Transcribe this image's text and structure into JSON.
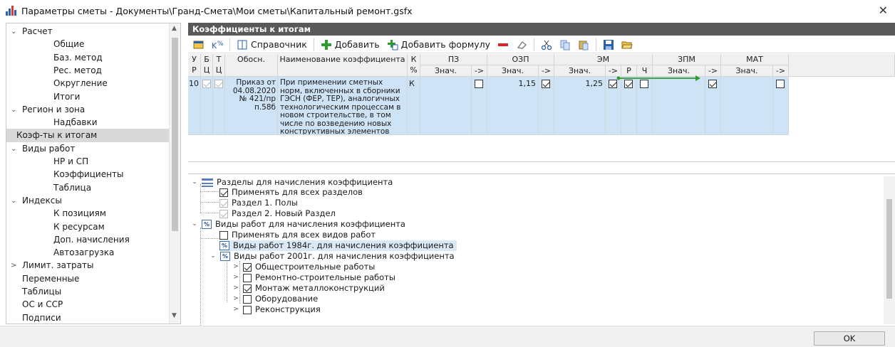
{
  "window": {
    "title": "Параметры сметы - Документы\\Гранд-Смета\\Мои сметы\\Капитальный ремонт.gsfx"
  },
  "sidebar": {
    "items": [
      {
        "label": "Расчет",
        "level": 0,
        "arrow": "⌄"
      },
      {
        "label": "Общие",
        "level": 1
      },
      {
        "label": "Баз. метод",
        "level": 1
      },
      {
        "label": "Рес. метод",
        "level": 1
      },
      {
        "label": "Округление",
        "level": 1
      },
      {
        "label": "Итоги",
        "level": 1
      },
      {
        "label": "Регион и зона",
        "level": 0,
        "arrow": "⌄"
      },
      {
        "label": "Надбавки",
        "level": 1
      },
      {
        "label": "Коэф-ты к итогам",
        "level": 0,
        "selected": true
      },
      {
        "label": "Виды работ",
        "level": 0,
        "arrow": "⌄"
      },
      {
        "label": "НР и СП",
        "level": 1
      },
      {
        "label": "Коэффициенты",
        "level": 1
      },
      {
        "label": "Таблица",
        "level": 1
      },
      {
        "label": "Индексы",
        "level": 0,
        "arrow": "⌄"
      },
      {
        "label": "К позициям",
        "level": 1
      },
      {
        "label": "К ресурсам",
        "level": 1
      },
      {
        "label": "Доп. начисления",
        "level": 1
      },
      {
        "label": "Автозагрузка",
        "level": 1
      },
      {
        "label": "Лимит. затраты",
        "level": 0,
        "arrow": ">"
      },
      {
        "label": "Переменные",
        "level": 0
      },
      {
        "label": "Таблицы",
        "level": 0
      },
      {
        "label": "ОС и ССР",
        "level": 0
      },
      {
        "label": "Подписи",
        "level": 0
      }
    ]
  },
  "section": {
    "title": "Коэффициенты к итогам"
  },
  "toolbar": {
    "reference_label": "Справочник",
    "add_label": "Добавить",
    "add_formula_label": "Добавить формулу"
  },
  "grid": {
    "headers": {
      "ur": "У\nР",
      "bc": "Б\nЦ",
      "tc": "Т\nЦ",
      "basis": "Обосн.",
      "name": "Наименование коэффициента",
      "kpct": "К\n%",
      "pz": "ПЗ",
      "ozp": "ОЗП",
      "em": "ЭМ",
      "zpm": "ЗПМ",
      "mat": "МАТ",
      "val": "Знач.",
      "arrow": "->",
      "r": "Р",
      "ch": "Ч"
    },
    "row": {
      "ur": "10",
      "basis": "Приказ от 04.08.2020 № 421/пр п.58б",
      "name": "При применении сметных норм, включенных в сборники ГЭСН (ФЕР, ТЕР), аналогичных технологическим процессам в новом строительстве, в том числе по возведению новых конструктивных элементов",
      "k": "К",
      "ozp_value": "1,15",
      "em_value": "1,25"
    }
  },
  "tree": {
    "sections_root": "Разделы для начисления коэффициента",
    "apply_all_sections": "Применять для всех разделов",
    "section1": "Раздел 1. Полы",
    "section2": "Раздел 2. Новый Раздел",
    "worktypes_root": "Виды работ для начисления коэффициента",
    "apply_all_worktypes": "Применять для всех видов работ",
    "wt1984": "Виды работ 1984г. для начисления коэффициента",
    "wt2001": "Виды работ 2001г. для начисления коэффициента",
    "general": "Общестроительные работы",
    "repair": "Ремонтно-строительные работы",
    "metal": "Монтаж металлоконструкций",
    "equipment": "Оборудование",
    "reconstruction": "Реконструкция",
    "pct_glyph": "%"
  },
  "footer": {
    "ok_label": "OK"
  },
  "colors": {
    "header_bar": "#595959",
    "selected_row": "#cfe3f7",
    "accent_blue": "#2a5fae",
    "green_add": "#2e9b2e",
    "red_remove": "#d9242a"
  }
}
